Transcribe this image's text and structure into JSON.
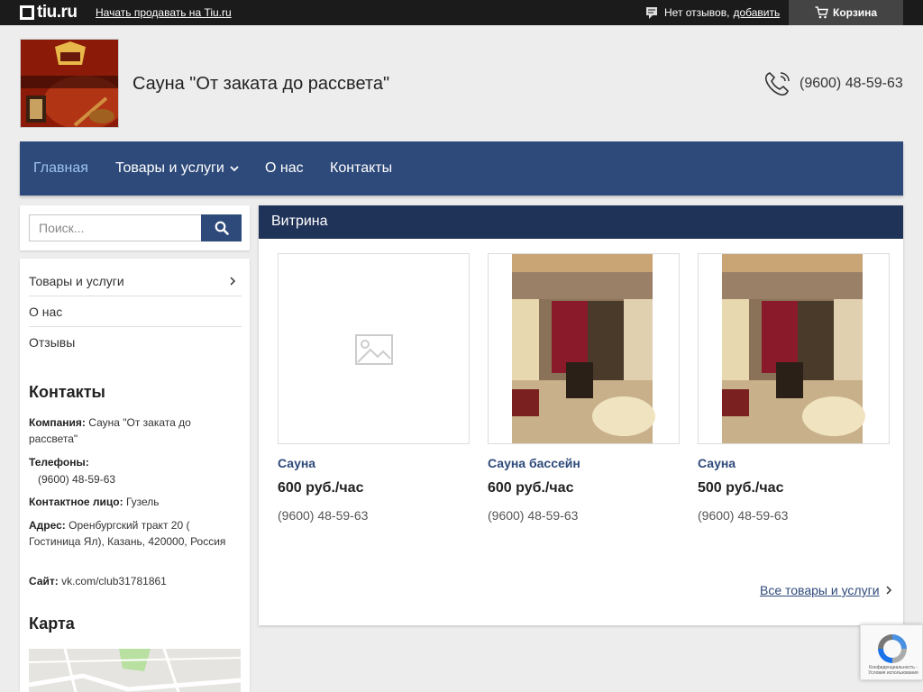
{
  "topbar": {
    "logo_text": "tiu.ru",
    "sell_link": "Начать продавать на Tiu.ru",
    "reviews_text": "Нет отзывов,",
    "reviews_link": "добавить",
    "cart_label": "Корзина"
  },
  "header": {
    "shop_title": "Сауна \"От заката до рассвета\"",
    "phone": "(9600) 48-59-63"
  },
  "nav": {
    "items": [
      {
        "label": "Главная",
        "active": true
      },
      {
        "label": "Товары и услуги",
        "has_dropdown": true
      },
      {
        "label": "О нас"
      },
      {
        "label": "Контакты"
      }
    ]
  },
  "search": {
    "placeholder": "Поиск..."
  },
  "sidebar": {
    "menu": [
      "Товары и услуги",
      "О нас",
      "Отзывы"
    ],
    "contacts_title": "Контакты",
    "company_label": "Компания:",
    "company_value": "Сауна \"От заката до рассвета\"",
    "phones_label": "Телефоны:",
    "phones_value": "(9600) 48-59-63",
    "person_label": "Контактное лицо:",
    "person_value": "Гузель",
    "address_label": "Адрес:",
    "address_value": "Оренбургский тракт 20 ( Гостиница Ял), Казань, 420000, Россия",
    "site_label": "Сайт:",
    "site_value": "vk.com/club31781861",
    "map_title": "Карта"
  },
  "main": {
    "title": "Витрина",
    "products": [
      {
        "name": "Сауна",
        "price": "600 руб./час",
        "phone": "(9600) 48-59-63",
        "image": "placeholder-image-icon"
      },
      {
        "name": "Сауна бассейн",
        "price": "600 руб./час",
        "phone": "(9600) 48-59-63",
        "image": "sauna-room-photo"
      },
      {
        "name": "Сауна",
        "price": "500 руб./час",
        "phone": "(9600) 48-59-63",
        "image": "sauna-room-photo"
      }
    ],
    "all_link": "Все товары и услуги"
  },
  "recaptcha": {
    "text": "Конфиденциальность - Условия использования"
  },
  "colors": {
    "topbar": "#1b1b1b",
    "nav": "#2e4a7a",
    "nav_active": "#9ec3f0",
    "main_header": "#1f3258",
    "link": "#2e4a7a"
  }
}
